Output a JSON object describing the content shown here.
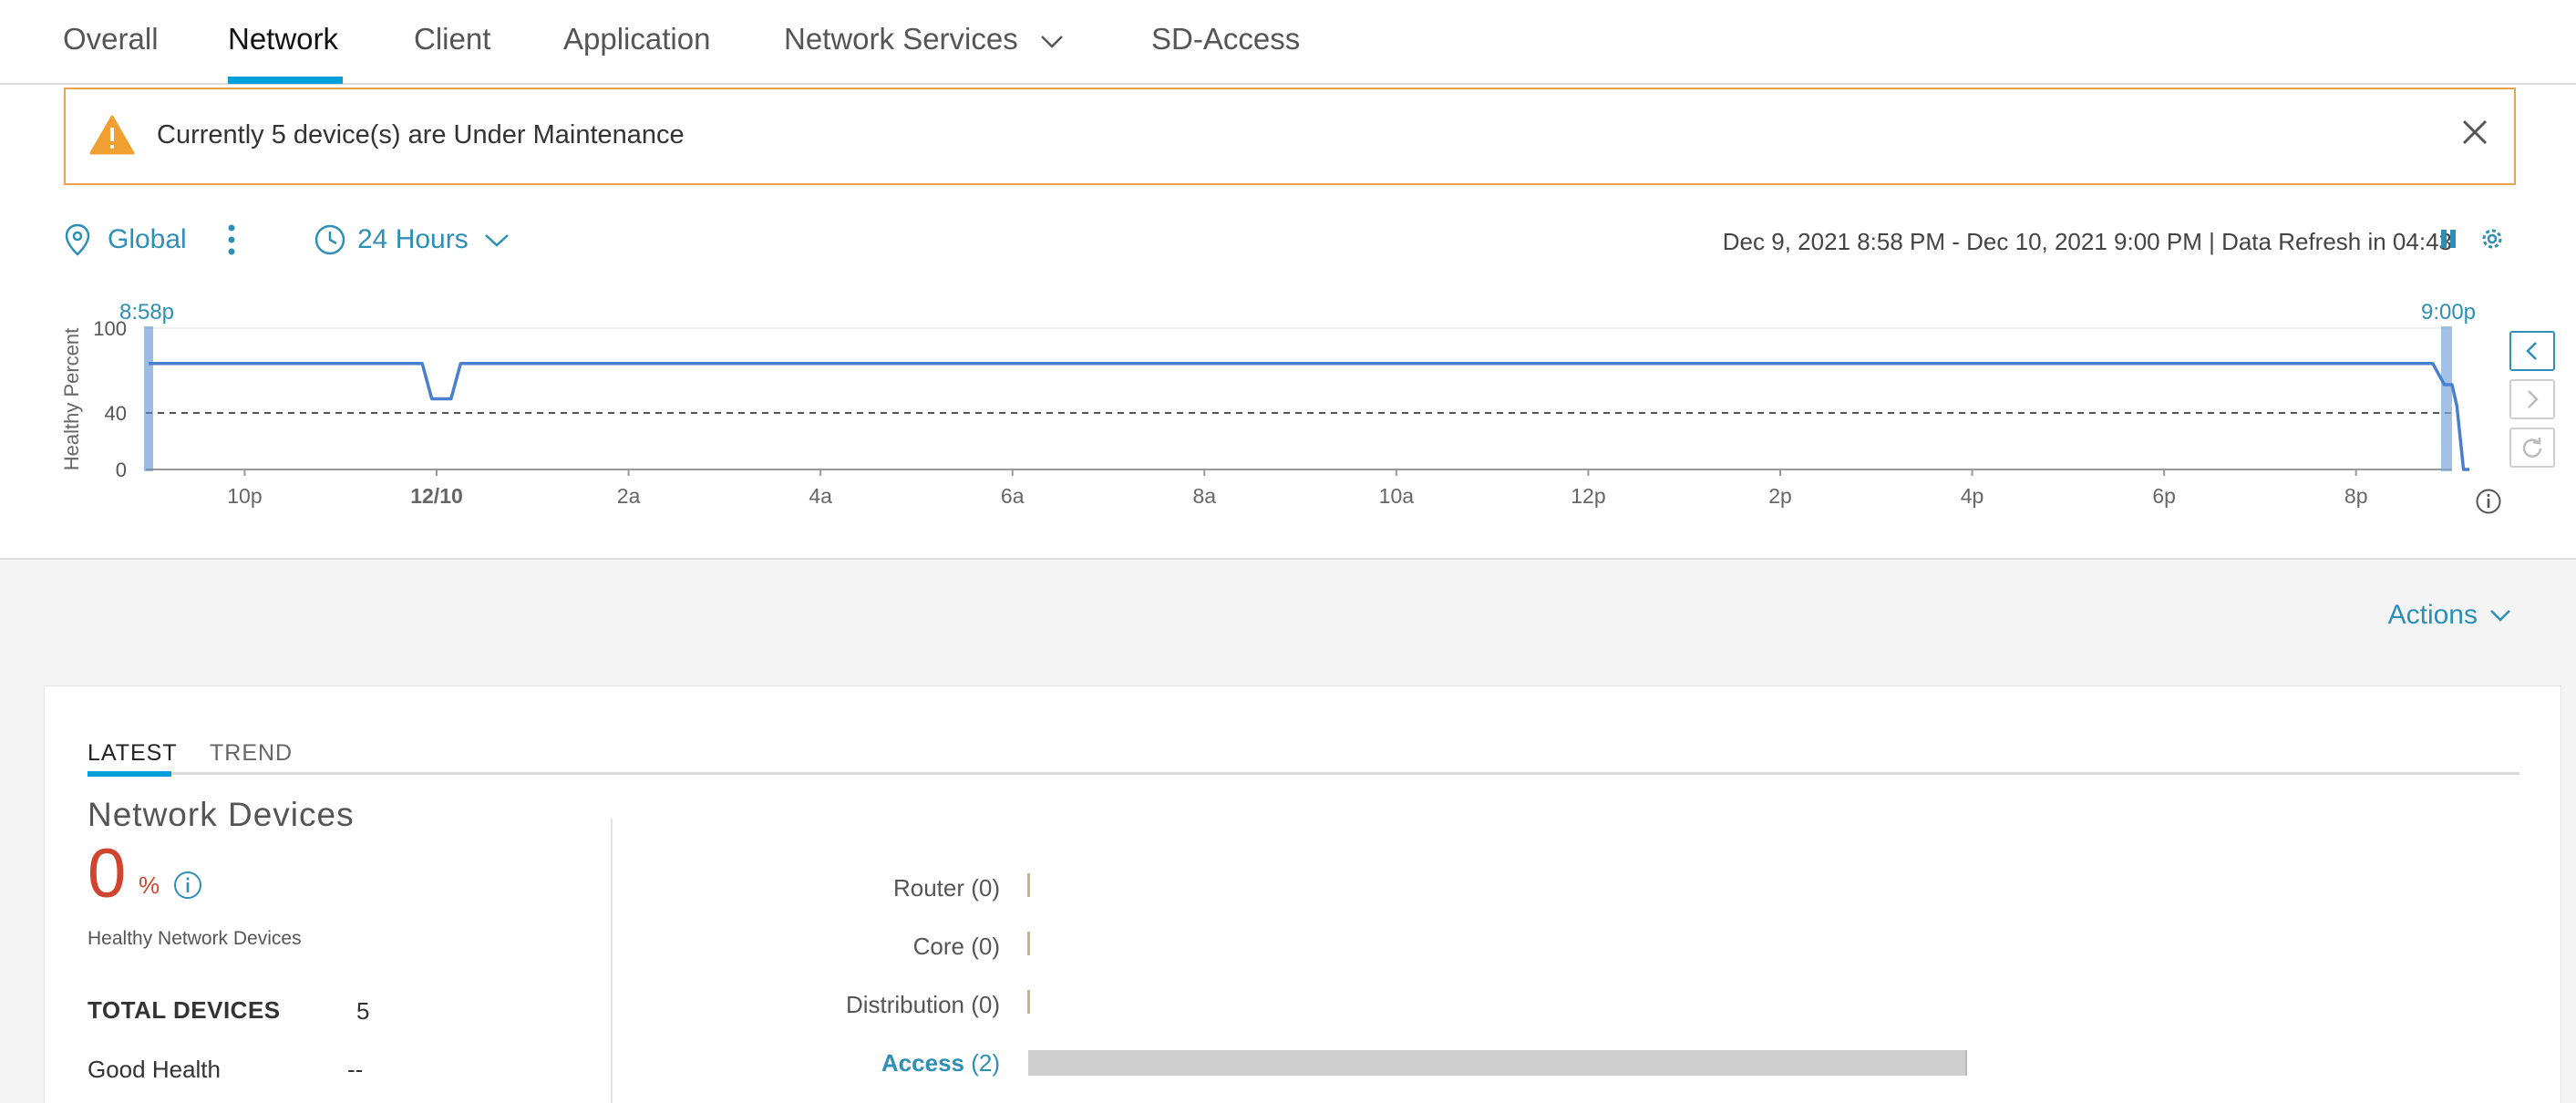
{
  "tabs": {
    "overall": "Overall",
    "network": "Network",
    "client": "Client",
    "application": "Application",
    "network_services": "Network Services",
    "sd_access": "SD-Access"
  },
  "banner": {
    "message": "Currently 5 device(s) are Under Maintenance"
  },
  "filters": {
    "location": "Global",
    "time_range": "24 Hours",
    "date_range": "Dec 9, 2021 8:58 PM - Dec 10, 2021 9:00 PM | Data Refresh in 04:43"
  },
  "chart_data": {
    "type": "line",
    "ylabel": "Healthy Percent",
    "ylim": [
      0,
      100
    ],
    "yticks": [
      "0",
      "40",
      "100"
    ],
    "threshold": 40,
    "x_ticks": [
      "10p",
      "12/10",
      "2a",
      "4a",
      "6a",
      "8a",
      "10a",
      "12p",
      "2p",
      "4p",
      "6p",
      "8p"
    ],
    "x_range_hours": [
      -1.03,
      23.0
    ],
    "selection_start_label": "8:58p",
    "selection_end_label": "9:00p",
    "series": [
      {
        "color": "#4a7fd0",
        "x": [
          -1.0,
          1.85,
          1.95,
          2.15,
          2.25,
          22.8,
          22.92,
          23.0,
          23.05,
          23.12,
          23.18
        ],
        "y": [
          75,
          75,
          50,
          50,
          75,
          75,
          60,
          60,
          45,
          0,
          0
        ]
      }
    ]
  },
  "actions_label": "Actions",
  "subtabs": {
    "latest": "LATEST",
    "trend": "TREND"
  },
  "network_devices": {
    "title": "Network Devices",
    "score": "0",
    "unit": "%",
    "healthy_label": "Healthy Network Devices",
    "total_label": "TOTAL DEVICES",
    "total_value": "5",
    "good_label": "Good Health",
    "good_value": "--"
  },
  "categories": [
    {
      "name": "Router",
      "count": "(0)",
      "value": 0,
      "link": false
    },
    {
      "name": "Core",
      "count": "(0)",
      "value": 0,
      "link": false
    },
    {
      "name": "Distribution",
      "count": "(0)",
      "value": 0,
      "link": false
    },
    {
      "name": "Access",
      "count": "(2)",
      "value": 2,
      "link": true
    }
  ],
  "category_scale_max": 2
}
